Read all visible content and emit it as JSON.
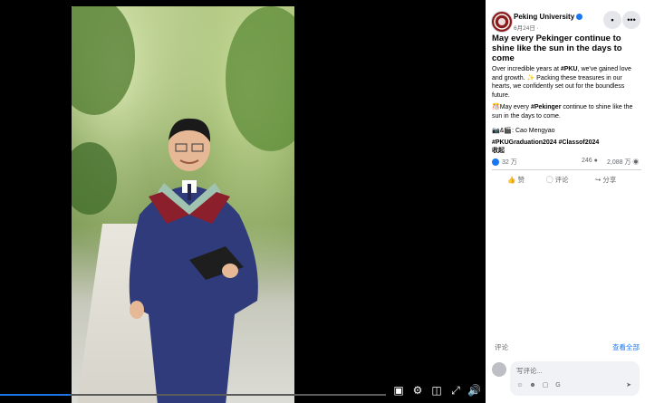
{
  "post": {
    "page_name": "Peking University",
    "date": "6月24日 · ",
    "title": "May every Pekinger continue to shine like the sun in the days to come",
    "para1_prefix": "Over incredible years at ",
    "para1_tag": "#PKU",
    "para1_suffix": ", we've gained love and growth. ✨ Packing these treasures in our hearts, we confidently set out for the boundless future.",
    "para2_prefix": "🎊May every ",
    "para2_tag": "#Pekinger",
    "para2_suffix": " continue to shine like the sun in the days to come.",
    "credit": "📷&🎬: Cao Mengyao",
    "hashtags": "#PKUGraduation2024 #Classof2024",
    "collapse": "收起",
    "reaction_count": "32 万",
    "comment_count": "246",
    "share_count": "2,088 万",
    "actions": {
      "like": "赞",
      "comment": "评论",
      "share": "分享"
    },
    "comments_label": "评论",
    "see_all": "查看全部",
    "comment_placeholder": "写评论..."
  },
  "video": {
    "progress": 0.18
  }
}
